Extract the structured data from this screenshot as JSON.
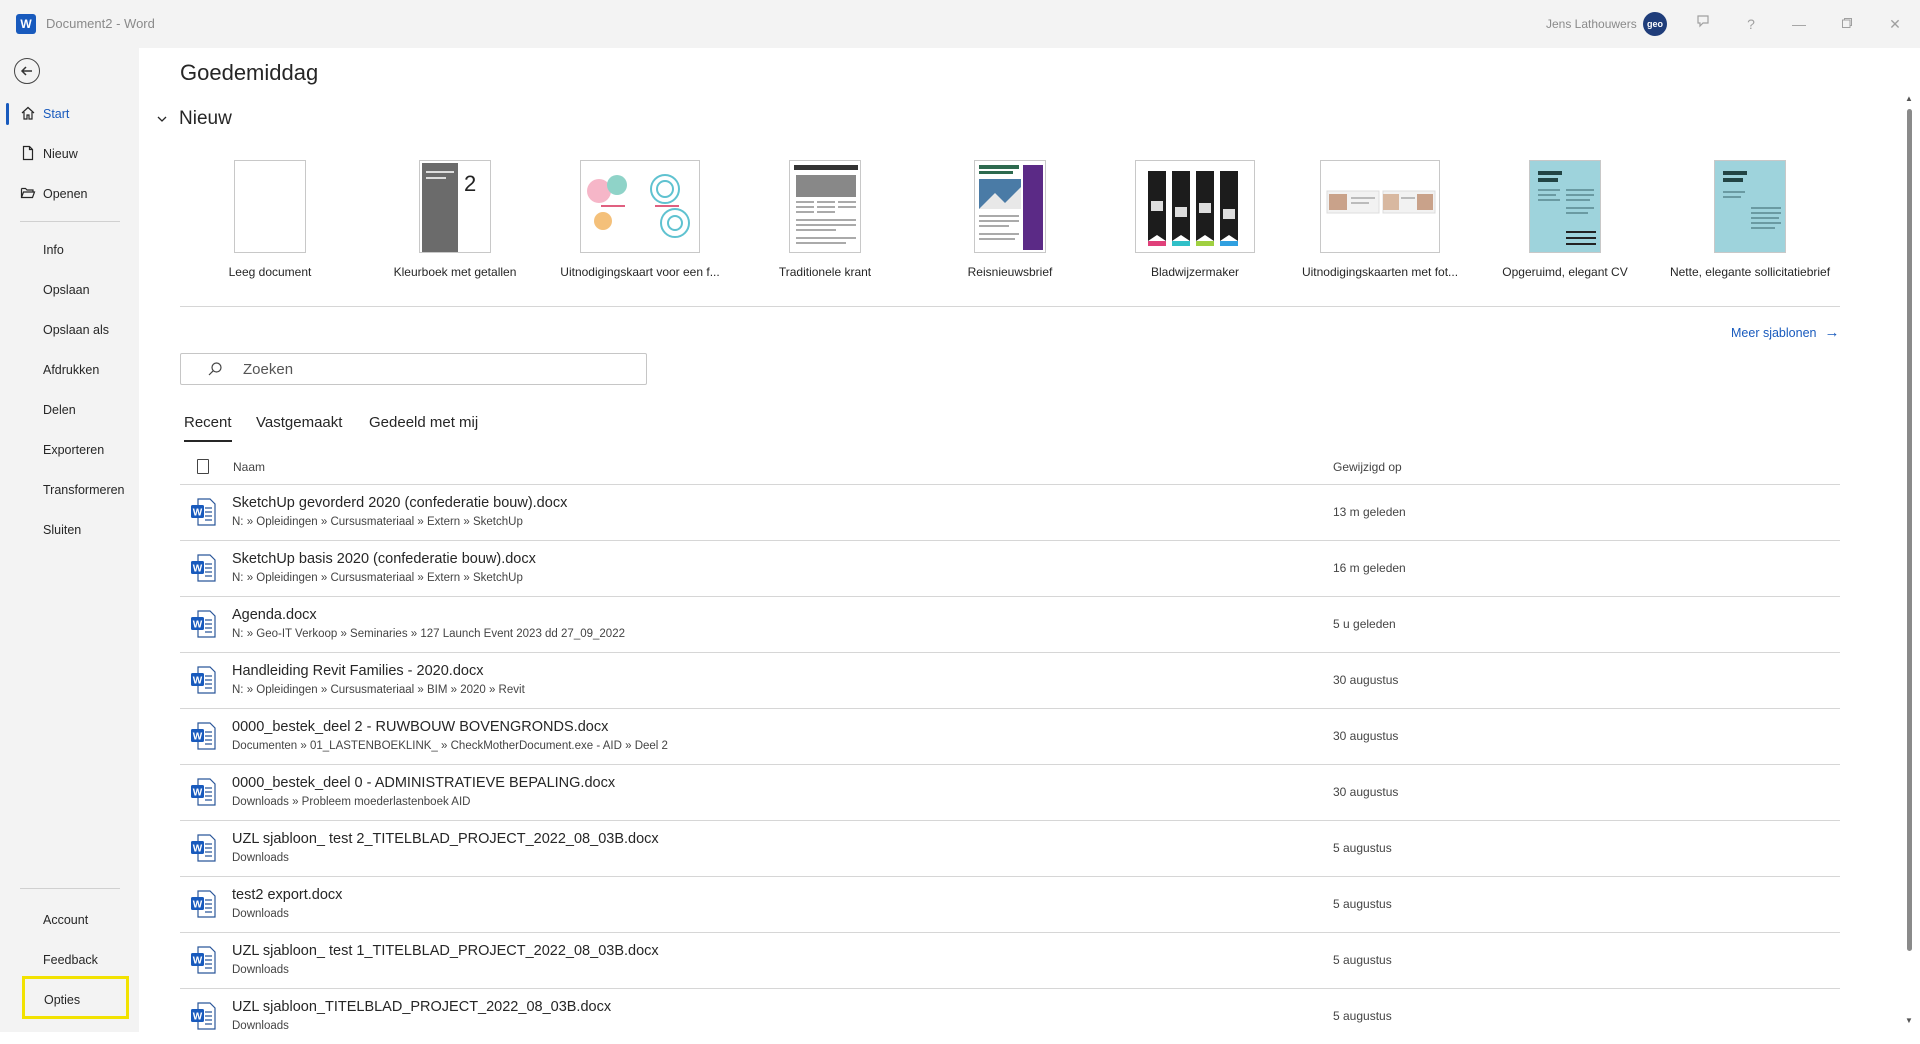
{
  "titlebar": {
    "title": "Document2  -  Word",
    "user_name": "Jens Lathouwers",
    "avatar_text": "geo"
  },
  "nav": {
    "items": [
      {
        "label": "Start",
        "active": true
      },
      {
        "label": "Nieuw"
      },
      {
        "label": "Openen"
      },
      {
        "label": "Info"
      },
      {
        "label": "Opslaan"
      },
      {
        "label": "Opslaan als"
      },
      {
        "label": "Afdrukken"
      },
      {
        "label": "Delen"
      },
      {
        "label": "Exporteren"
      },
      {
        "label": "Transformeren"
      },
      {
        "label": "Sluiten"
      }
    ],
    "bottom": [
      {
        "label": "Account"
      },
      {
        "label": "Feedback"
      },
      {
        "label": "Opties",
        "highlighted": true
      }
    ]
  },
  "main": {
    "greeting": "Goedemiddag",
    "new_section": "Nieuw",
    "templates": [
      {
        "label": "Leeg document"
      },
      {
        "label": "Kleurboek met getallen"
      },
      {
        "label": "Uitnodigingskaart voor een f..."
      },
      {
        "label": "Traditionele krant"
      },
      {
        "label": "Reisnieuwsbrief"
      },
      {
        "label": "Bladwijzermaker"
      },
      {
        "label": "Uitnodigingskaarten met fot..."
      },
      {
        "label": "Opgeruimd, elegant CV"
      },
      {
        "label": "Nette, elegante sollicitatiebrief"
      }
    ],
    "more_templates": "Meer sjablonen",
    "search_placeholder": "Zoeken",
    "tabs": [
      "Recent",
      "Vastgemaakt",
      "Gedeeld met mij"
    ],
    "columns": {
      "name": "Naam",
      "modified": "Gewijzigd op"
    },
    "files": [
      {
        "name": "SketchUp gevorderd 2020 (confederatie bouw).docx",
        "path": "N: » Opleidingen » Cursusmateriaal » Extern » SketchUp",
        "date": "13 m geleden"
      },
      {
        "name": "SketchUp basis 2020 (confederatie bouw).docx",
        "path": "N: » Opleidingen » Cursusmateriaal » Extern » SketchUp",
        "date": "16 m geleden"
      },
      {
        "name": "Agenda.docx",
        "path": "N: » Geo-IT Verkoop » Seminaries » 127 Launch Event 2023 dd 27_09_2022",
        "date": "5 u geleden"
      },
      {
        "name": "Handleiding Revit Families - 2020.docx",
        "path": "N: » Opleidingen » Cursusmateriaal » BIM » 2020 » Revit",
        "date": "30 augustus"
      },
      {
        "name": "0000_bestek_deel 2 - RUWBOUW BOVENGRONDS.docx",
        "path": "Documenten » 01_LASTENBOEKLINK_ » CheckMotherDocument.exe - AID » Deel 2",
        "date": "30 augustus"
      },
      {
        "name": "0000_bestek_deel 0 - ADMINISTRATIEVE BEPALING.docx",
        "path": "Downloads » Probleem moederlastenboek AID",
        "date": "30 augustus"
      },
      {
        "name": "UZL sjabloon_ test 2_TITELBLAD_PROJECT_2022_08_03B.docx",
        "path": "Downloads",
        "date": "5 augustus"
      },
      {
        "name": "test2 export.docx",
        "path": "Downloads",
        "date": "5 augustus"
      },
      {
        "name": "UZL sjabloon_ test 1_TITELBLAD_PROJECT_2022_08_03B.docx",
        "path": "Downloads",
        "date": "5 augustus"
      },
      {
        "name": "UZL sjabloon_TITELBLAD_PROJECT_2022_08_03B.docx",
        "path": "Downloads",
        "date": "5 augustus"
      }
    ]
  },
  "colors": {
    "accent": "#185abd",
    "highlight": "#f2e200"
  }
}
